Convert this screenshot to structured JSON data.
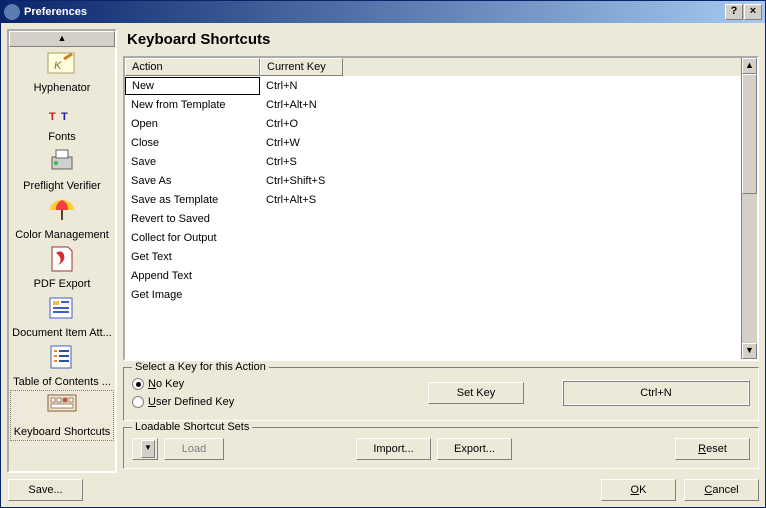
{
  "window": {
    "title": "Preferences"
  },
  "sidebar": {
    "items": [
      {
        "label": "Hyphenator",
        "icon": "hyphenator"
      },
      {
        "label": "Fonts",
        "icon": "fonts"
      },
      {
        "label": "Preflight Verifier",
        "icon": "printer"
      },
      {
        "label": "Color Management",
        "icon": "umbrella"
      },
      {
        "label": "PDF Export",
        "icon": "pdf"
      },
      {
        "label": "Document Item Att...",
        "icon": "docitem"
      },
      {
        "label": "Table of Contents ...",
        "icon": "toc"
      },
      {
        "label": "Keyboard Shortcuts",
        "icon": "keyboard"
      }
    ],
    "selected_index": 7
  },
  "main": {
    "title": "Keyboard Shortcuts",
    "columns": {
      "action": "Action",
      "key": "Current Key"
    },
    "rows": [
      {
        "action": "New",
        "key": "Ctrl+N"
      },
      {
        "action": "New from Template",
        "key": "Ctrl+Alt+N"
      },
      {
        "action": "Open",
        "key": "Ctrl+O"
      },
      {
        "action": "Close",
        "key": "Ctrl+W"
      },
      {
        "action": "Save",
        "key": "Ctrl+S"
      },
      {
        "action": "Save As",
        "key": "Ctrl+Shift+S"
      },
      {
        "action": "Save as Template",
        "key": "Ctrl+Alt+S"
      },
      {
        "action": "Revert to Saved",
        "key": ""
      },
      {
        "action": "Collect for Output",
        "key": ""
      },
      {
        "action": "Get Text",
        "key": ""
      },
      {
        "action": "Append Text",
        "key": ""
      },
      {
        "action": "Get Image",
        "key": ""
      }
    ],
    "selected_row": 0
  },
  "select_key": {
    "legend": "Select a Key for this Action",
    "no_key": "No Key",
    "user_key": "User Defined Key",
    "selected": "no_key",
    "set_key_btn": "Set Key",
    "current_display": "Ctrl+N"
  },
  "loadable": {
    "legend": "Loadable Shortcut Sets",
    "load_btn": "Load",
    "import_btn": "Import...",
    "export_btn": "Export...",
    "reset_btn": "Reset"
  },
  "footer": {
    "save_btn": "Save...",
    "ok_btn": "OK",
    "cancel_btn": "Cancel"
  }
}
